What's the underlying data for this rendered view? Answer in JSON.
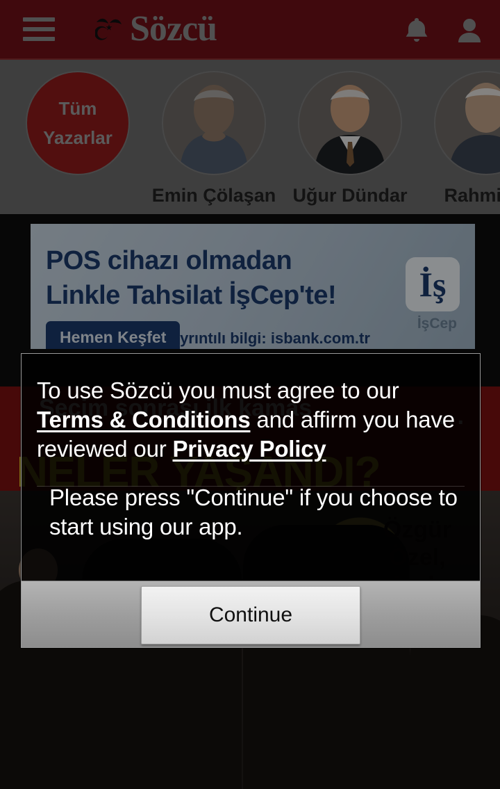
{
  "header": {
    "menu_icon": "hamburger-menu-icon",
    "logo_text": "Sözcü",
    "logo_mark": "turkish-flag-birds-icon",
    "notifications_icon": "bell-icon",
    "account_icon": "person-icon"
  },
  "authors": {
    "all_writers_line1": "Tüm",
    "all_writers_line2": "Yazarlar",
    "items": [
      {
        "name": "Emin Çölaşan"
      },
      {
        "name": "Uğur Dündar"
      },
      {
        "name": "Rahmi Tu"
      }
    ]
  },
  "banner_ad": {
    "line1": "POS cihazı olmadan",
    "line2": "Linkle Tahsilat İşCep'te!",
    "cta_label": "Hemen Keşfet",
    "info_text": "Ayrıntılı bilgi: isbank.com.tr",
    "bank_glyph": "İş",
    "bank_label": "İşCep"
  },
  "hero": {
    "kicker": "Seçim sonrası ilk kamas",
    "dots": "...",
    "title": "NELER YAŞANDI?",
    "badge_text": "Özgür Özel, inek"
  },
  "dialog": {
    "paragraph1_part1": "To use Sözcü you must agree to our ",
    "terms_link": "Terms & Conditions",
    "paragraph1_part2": " and affirm you have reviewed our ",
    "privacy_link": "Privacy Policy",
    "paragraph2": "Please press \"Continue\" if you choose to start using our app.",
    "continue_label": "Continue"
  },
  "colors": {
    "header_red": "#6e1018",
    "all_writers_red": "#8e1a1a",
    "banner_blue": "#1b3a6b",
    "dialog_bg": "rgba(0,0,0,0.86)",
    "footer_gray": "#9c9c9c"
  }
}
